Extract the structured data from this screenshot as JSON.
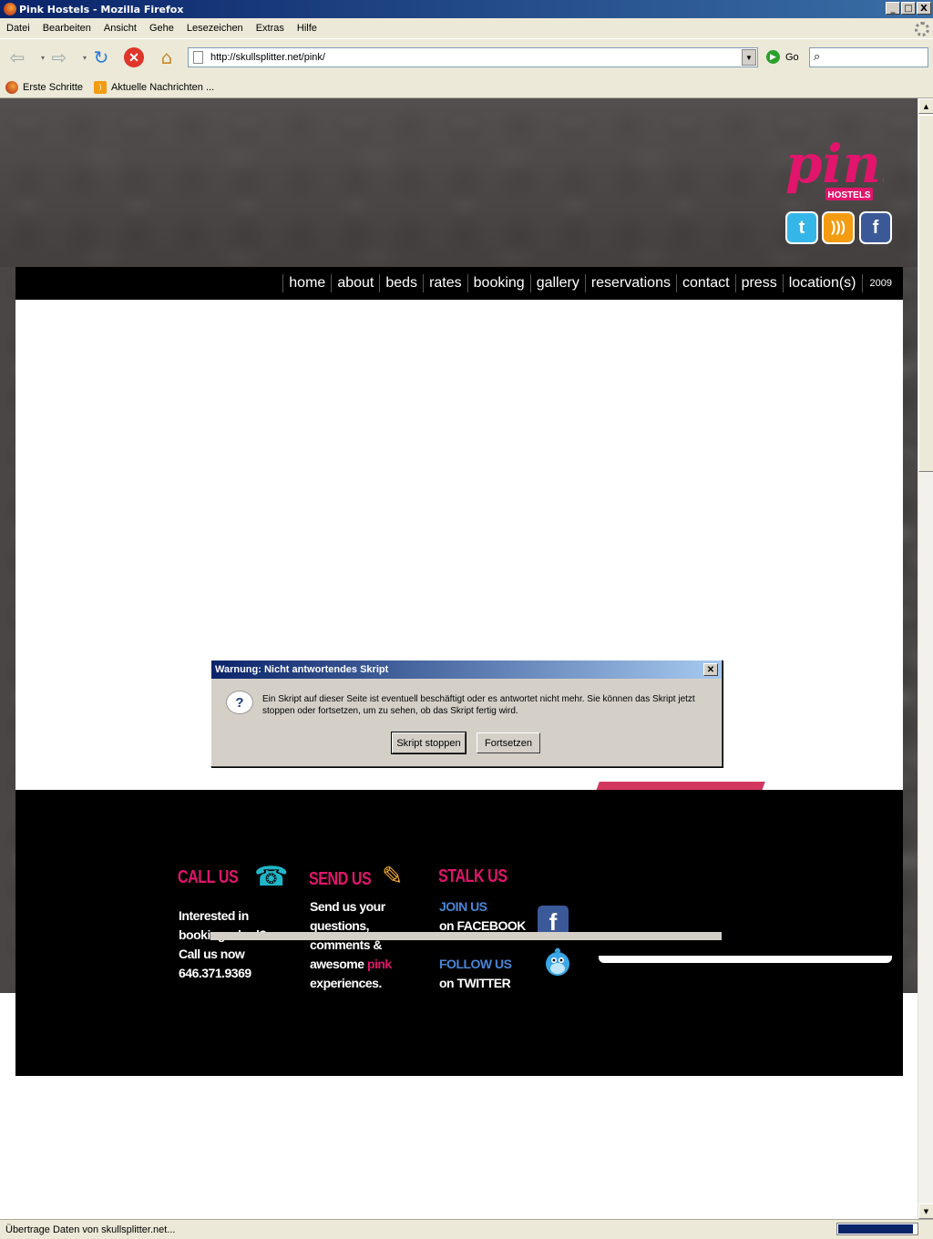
{
  "window": {
    "title": "Pink Hostels - Mozilla Firefox",
    "buttons": [
      "_",
      "□",
      "X"
    ]
  },
  "menu": [
    "Datei",
    "Bearbeiten",
    "Ansicht",
    "Gehe",
    "Lesezeichen",
    "Extras",
    "Hilfe"
  ],
  "toolbar": {
    "url": "http://skullsplitter.net/pink/",
    "go_label": "Go",
    "search_placeholder": ""
  },
  "bookmarks": [
    "Erste Schritte",
    "Aktuelle Nachrichten ..."
  ],
  "site": {
    "logo_text": "pink",
    "logo_sub": "HOSTELS",
    "social_icons": [
      "twitter-icon",
      "rss-icon",
      "facebook-icon"
    ],
    "nav": [
      "home",
      "about",
      "beds",
      "rates",
      "booking",
      "gallery",
      "reservations",
      "contact",
      "press",
      "location(s)"
    ],
    "nav_year": "2009",
    "colors": {
      "pink": "#e0156b",
      "blue": "#4a86d6"
    }
  },
  "footer": {
    "call": {
      "heading": "CALL US",
      "lines": [
        "Interested in",
        "booking a bed?",
        "Call us now",
        "646.371.9369"
      ]
    },
    "send": {
      "heading": "SEND US",
      "lines": [
        "Send us your",
        "questions,",
        "comments &"
      ],
      "line4_prefix": "awesome ",
      "line4_pink": "pink",
      "line5": "experiences."
    },
    "stalk": {
      "heading": "STALK US",
      "join": "JOIN US",
      "facebook": "on FACEBOOK",
      "follow": "FOLLOW US",
      "twitter": "on TWITTER"
    }
  },
  "dialog": {
    "title": "Warnung: Nicht antwortendes Skript",
    "message": "Ein Skript auf dieser Seite ist eventuell beschäftigt oder es antwortet nicht mehr. Sie können das Skript jetzt stoppen oder fortsetzen, um zu sehen, ob das Skript fertig wird.",
    "stop_label": "Skript stoppen",
    "continue_label": "Fortsetzen"
  },
  "status": {
    "text": "Übertrage Daten von skullsplitter.net...",
    "progress": 0.95
  }
}
